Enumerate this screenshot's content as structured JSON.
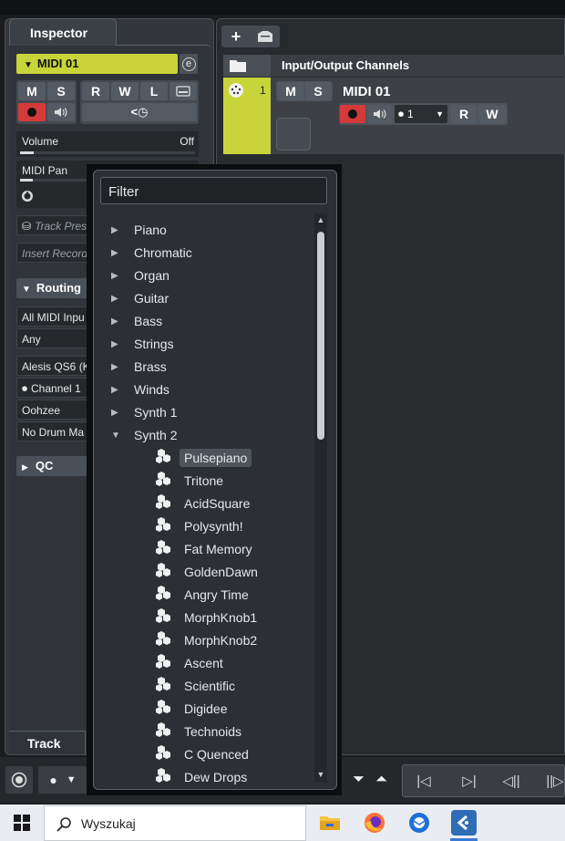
{
  "inspector": {
    "tab_label": "Inspector",
    "track_name": "MIDI 01",
    "mute": "M",
    "solo": "S",
    "read": "R",
    "write": "W",
    "lanes": "L",
    "volume_label": "Volume",
    "volume_value": "Off",
    "pan_label": "MIDI Pan",
    "track_preset_placeholder": "Track Pres",
    "insert_record_placeholder": "Insert Record",
    "routing_label": "Routing",
    "routing_input": "All MIDI Inpu",
    "routing_channel_in": "Any",
    "routing_output": "Alesis QS6 (K",
    "routing_channel": "Channel 1",
    "routing_program": "Oohzee",
    "routing_drum": "No Drum Ma",
    "qc_label": "QC",
    "bottom_tab": "Track"
  },
  "project": {
    "folder_title": "Input/Output Channels",
    "track_number": "1",
    "track_name": "MIDI 01",
    "mute": "M",
    "solo": "S",
    "channel_value": "1",
    "read": "R",
    "write": "W"
  },
  "popup": {
    "filter_placeholder": "Filter",
    "categories": [
      {
        "label": "Piano",
        "expanded": false
      },
      {
        "label": "Chromatic",
        "expanded": false
      },
      {
        "label": "Organ",
        "expanded": false
      },
      {
        "label": "Guitar",
        "expanded": false
      },
      {
        "label": "Bass",
        "expanded": false
      },
      {
        "label": "Strings",
        "expanded": false
      },
      {
        "label": "Brass",
        "expanded": false
      },
      {
        "label": "Winds",
        "expanded": false
      },
      {
        "label": "Synth 1",
        "expanded": false
      },
      {
        "label": "Synth 2",
        "expanded": true
      }
    ],
    "presets": [
      "Pulsepiano",
      "Tritone",
      "AcidSquare",
      "Polysynth!",
      "Fat Memory",
      "GoldenDawn",
      "Angry Time",
      "MorphKnob1",
      "MorphKnob2",
      "Ascent",
      "Scientific",
      "Digidee",
      "Technoids",
      "C Quenced",
      "Dew Drops"
    ],
    "selected_preset": "Pulsepiano"
  },
  "taskbar": {
    "search_placeholder": "Wyszukaj"
  },
  "colors": {
    "track_color": "#c9d43a",
    "record_red": "#d43a3a"
  }
}
